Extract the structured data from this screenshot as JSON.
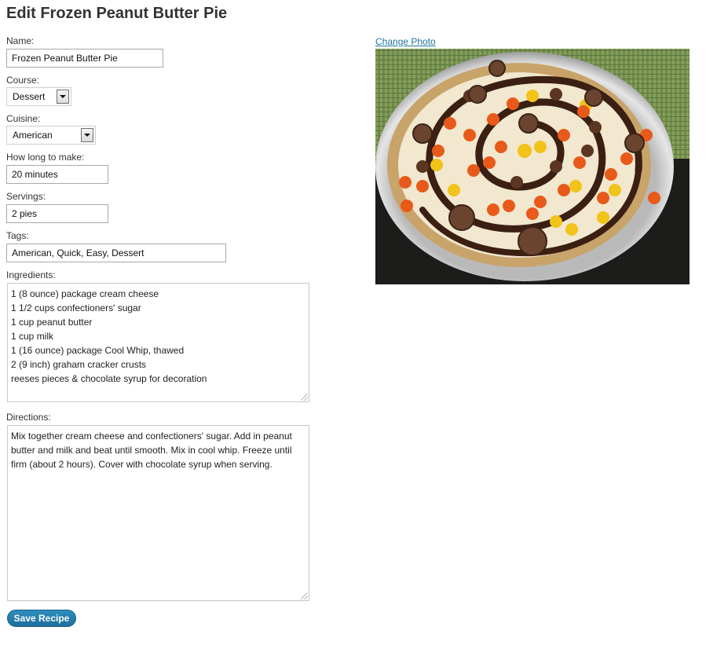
{
  "page": {
    "title": "Edit Frozen Peanut Butter Pie"
  },
  "form": {
    "name": {
      "label": "Name:",
      "value": "Frozen Peanut Butter Pie"
    },
    "course": {
      "label": "Course:",
      "value": "Dessert"
    },
    "cuisine": {
      "label": "Cuisine:",
      "value": "American"
    },
    "time": {
      "label": "How long to make:",
      "value": "20 minutes"
    },
    "servings": {
      "label": "Servings:",
      "value": "2 pies"
    },
    "tags": {
      "label": "Tags:",
      "value": "American, Quick, Easy, Dessert"
    },
    "ingredients": {
      "label": "Ingredients:",
      "lines": [
        "1 (8 ounce) package cream cheese",
        "1 1/2 cups confectioners' sugar",
        "1 cup peanut butter",
        "1 cup milk",
        "1 (16 ounce) package Cool Whip, thawed",
        "2 (9 inch) graham cracker crusts",
        "reeses pieces & chocolate syrup for decoration"
      ]
    },
    "directions": {
      "label": "Directions:",
      "value": "Mix together cream cheese and confectioners' sugar. Add in peanut butter and milk and beat until smooth. Mix in cool whip. Freeze until firm (about 2 hours). Cover with chocolate syrup when serving."
    },
    "save_label": "Save Recipe"
  },
  "photo": {
    "change_label": "Change Photo",
    "colors": {
      "placemat": "#6f8a4a",
      "tray": "#c9c9c9",
      "crust": "#c8a46a",
      "filling": "#f2e7cf",
      "syrup": "#3a1f12",
      "orange": "#e85a1a",
      "yellow": "#f2c318",
      "brown": "#5b3622"
    }
  },
  "colors": {
    "accent": "#21759b",
    "button": "#2384b3"
  }
}
